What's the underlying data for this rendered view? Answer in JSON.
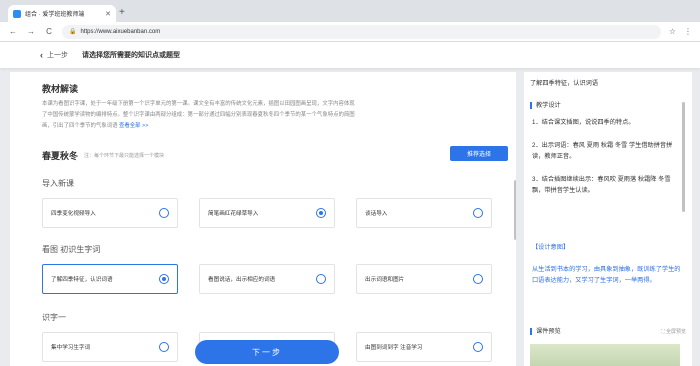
{
  "browser": {
    "tab_title": "组合 · 爱学班班教师端",
    "url": "https://www.aixuebanban.com"
  },
  "header": {
    "back_label": "上一步",
    "title": "请选择您所需要的知识点或题型"
  },
  "intro": {
    "title": "教材解读",
    "text": "本课为看图识字课，处于一年级下册第一个识字单元的第一课。课文全有丰富的传统文化元素，插图以田园图画呈现，文字内容体现了中国传统蒙学读物的编排特点。整个识字课由两部分组成：第一部分通过四幅分别表现春夏秋冬四个季节的某一个气象特点的简图画，引出了四个季节的气象词语",
    "more": "查看全部 >>"
  },
  "plan": {
    "title": "春夏秋冬",
    "note": "注：每个环节下最只能选择一个模块",
    "recommend_button": "推荐选择"
  },
  "groups": [
    {
      "label": "导入新课",
      "options": [
        {
          "label": "四季变化视频导入",
          "selected": false
        },
        {
          "label": "简笔画红花绿草导入",
          "selected": true
        },
        {
          "label": "谈话导入",
          "selected": false
        }
      ]
    },
    {
      "label": "看图 初识生字词",
      "options": [
        {
          "label": "了解四季特征，认识词语",
          "selected": true
        },
        {
          "label": "看图说话，出示相应的词语",
          "selected": false
        },
        {
          "label": "出示词语和图片",
          "selected": false
        }
      ]
    },
    {
      "label": "识字一",
      "options": [
        {
          "label": "集中学习生字词",
          "selected": false
        },
        {
          "label": "",
          "selected": false
        },
        {
          "label": "由图到词到字 注音学习",
          "selected": false
        }
      ]
    }
  ],
  "next_button": "下一步",
  "sidebar": {
    "selected_title": "了解四季特征，认识词语",
    "design_heading": "教学设计",
    "steps": [
      "1．结合课文插图，说说四季的特点。",
      "2．出示词语：春风  夏雨  秋霜  冬雪 学生借助拼音拼读，教师正音。",
      "3．结合插图继续出示：春风吹  夏雨落  秋霜降  冬雪飘，带拼音学生认读。"
    ],
    "intent_heading": "【设计意图】",
    "intent_text": "从生活到书本的学习，由具象到抽象，既训练了学生的口语表达能力，又学习了生字词，一举两得。",
    "preview_heading": "课件预览",
    "fullscreen_label": "全屏预览"
  }
}
